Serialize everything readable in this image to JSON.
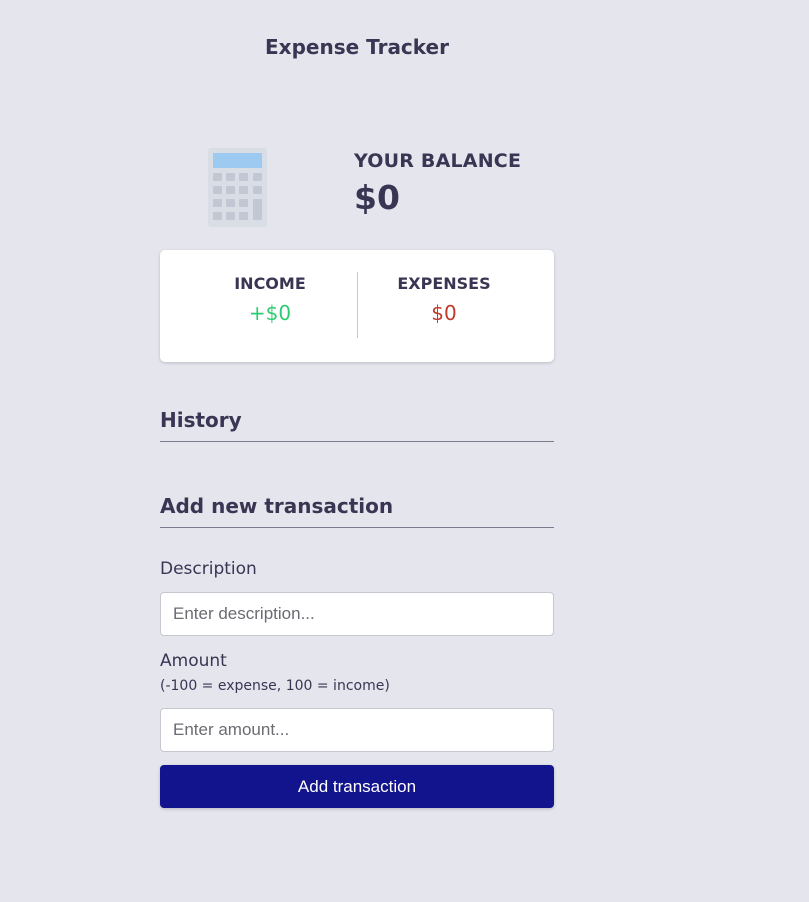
{
  "app": {
    "title": "Expense Tracker"
  },
  "balance": {
    "label": "YOUR BALANCE",
    "amount": "$0",
    "icon": "calculator-icon"
  },
  "summary": {
    "income_label": "INCOME",
    "income_value": "+$0",
    "expense_label": "EXPENSES",
    "expense_value": "$0"
  },
  "history": {
    "heading": "History",
    "items": []
  },
  "form": {
    "heading": "Add new transaction",
    "description_label": "Description",
    "description_placeholder": "Enter description...",
    "description_value": "",
    "amount_label": "Amount",
    "amount_hint": "(-100 = expense, 100 = income)",
    "amount_placeholder": "Enter amount...",
    "amount_value": "",
    "submit_label": "Add transaction"
  },
  "colors": {
    "background": "#e4e5ed",
    "text": "#3a3553",
    "income": "#2ecc71",
    "expense": "#c0392b",
    "button": "#12148d"
  }
}
